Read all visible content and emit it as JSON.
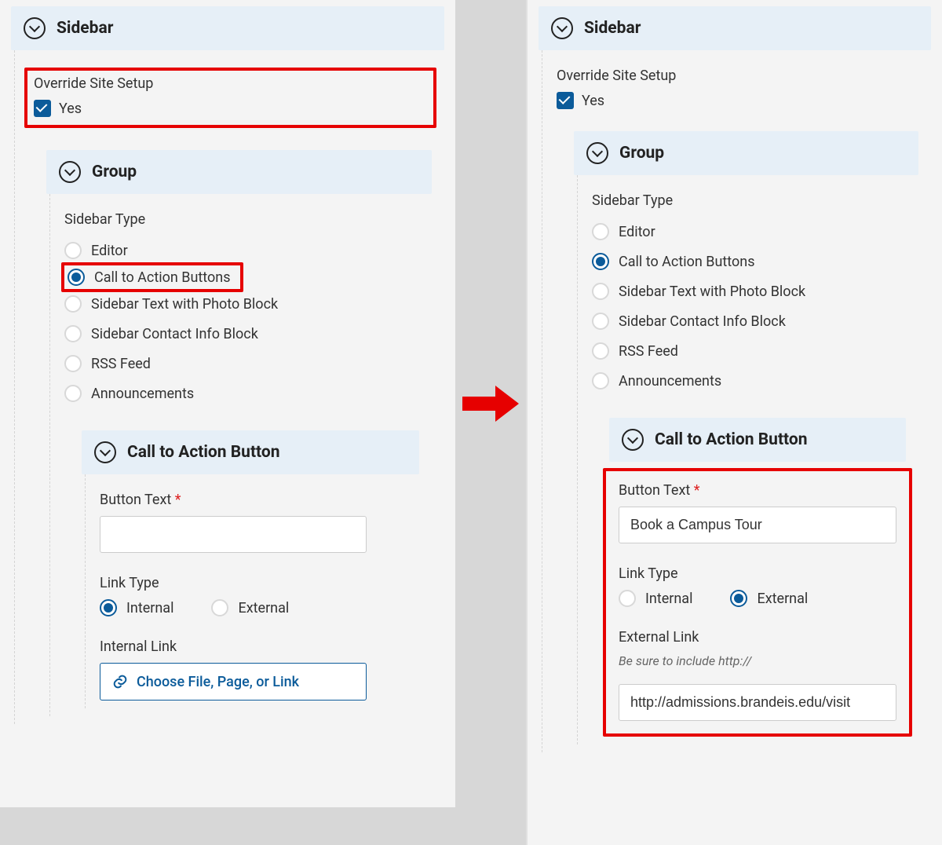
{
  "left": {
    "sidebar_title": "Sidebar",
    "override_label": "Override Site Setup",
    "override_value_label": "Yes",
    "group_title": "Group",
    "sidebar_type_label": "Sidebar Type",
    "sidebar_types": [
      {
        "label": "Editor",
        "selected": false
      },
      {
        "label": "Call to Action Buttons",
        "selected": true
      },
      {
        "label": "Sidebar Text with Photo Block",
        "selected": false
      },
      {
        "label": "Sidebar Contact Info Block",
        "selected": false
      },
      {
        "label": "RSS Feed",
        "selected": false
      },
      {
        "label": "Announcements",
        "selected": false
      }
    ],
    "cta_title": "Call to Action Button",
    "button_text_label": "Button Text",
    "button_text_value": "",
    "link_type_label": "Link Type",
    "link_types": [
      {
        "label": "Internal",
        "selected": true
      },
      {
        "label": "External",
        "selected": false
      }
    ],
    "internal_link_label": "Internal Link",
    "choose_label": "Choose File, Page, or Link"
  },
  "right": {
    "sidebar_title": "Sidebar",
    "override_label": "Override Site Setup",
    "override_value_label": "Yes",
    "group_title": "Group",
    "sidebar_type_label": "Sidebar Type",
    "sidebar_types": [
      {
        "label": "Editor",
        "selected": false
      },
      {
        "label": "Call to Action Buttons",
        "selected": true
      },
      {
        "label": "Sidebar Text with Photo Block",
        "selected": false
      },
      {
        "label": "Sidebar Contact Info Block",
        "selected": false
      },
      {
        "label": "RSS Feed",
        "selected": false
      },
      {
        "label": "Announcements",
        "selected": false
      }
    ],
    "cta_title": "Call to Action Button",
    "button_text_label": "Button Text",
    "button_text_value": "Book a Campus Tour",
    "link_type_label": "Link Type",
    "link_types": [
      {
        "label": "Internal",
        "selected": false
      },
      {
        "label": "External",
        "selected": true
      }
    ],
    "external_link_label": "External Link",
    "external_link_help": "Be sure to include http://",
    "external_link_value": "http://admissions.brandeis.edu/visit"
  },
  "required_marker": "*"
}
